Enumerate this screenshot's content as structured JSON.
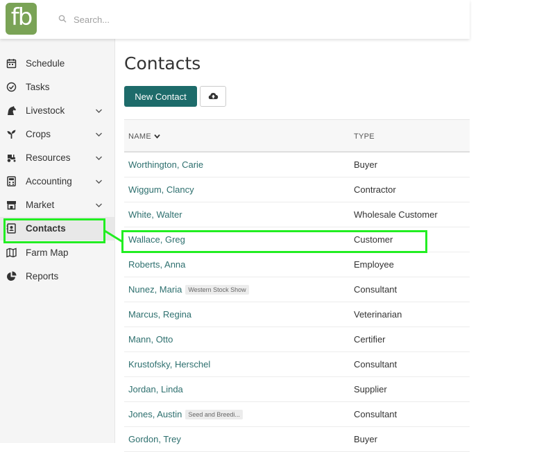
{
  "logo": {
    "text": "fb"
  },
  "search": {
    "placeholder": "Search..."
  },
  "sidebar": {
    "items": [
      {
        "label": "Schedule",
        "icon": "calendar-icon",
        "has_submenu": false
      },
      {
        "label": "Tasks",
        "icon": "check-circle-icon",
        "has_submenu": false
      },
      {
        "label": "Livestock",
        "icon": "horse-icon",
        "has_submenu": true
      },
      {
        "label": "Crops",
        "icon": "seedling-icon",
        "has_submenu": true
      },
      {
        "label": "Resources",
        "icon": "tractor-icon",
        "has_submenu": true
      },
      {
        "label": "Accounting",
        "icon": "calculator-icon",
        "has_submenu": true
      },
      {
        "label": "Market",
        "icon": "store-icon",
        "has_submenu": true
      },
      {
        "label": "Contacts",
        "icon": "address-book-icon",
        "has_submenu": false,
        "active": true
      },
      {
        "label": "Farm Map",
        "icon": "map-icon",
        "has_submenu": false
      },
      {
        "label": "Reports",
        "icon": "pie-chart-icon",
        "has_submenu": false
      }
    ]
  },
  "main": {
    "title": "Contacts",
    "new_button": "New Contact",
    "upload_icon": "cloud-upload-icon",
    "table": {
      "headers": {
        "name": "NAME",
        "type": "TYPE"
      },
      "rows": [
        {
          "name": "Worthington, Carie",
          "type": "Buyer",
          "tag": ""
        },
        {
          "name": "Wiggum, Clancy",
          "type": "Contractor",
          "tag": ""
        },
        {
          "name": "White, Walter",
          "type": "Wholesale Customer",
          "tag": ""
        },
        {
          "name": "Wallace, Greg",
          "type": "Customer",
          "tag": ""
        },
        {
          "name": "Roberts, Anna",
          "type": "Employee",
          "tag": ""
        },
        {
          "name": "Nunez, Maria",
          "type": "Consultant",
          "tag": "Western Stock Show"
        },
        {
          "name": "Marcus, Regina",
          "type": "Veterinarian",
          "tag": ""
        },
        {
          "name": "Mann, Otto",
          "type": "Certifier",
          "tag": ""
        },
        {
          "name": "Krustofsky, Herschel",
          "type": "Consultant",
          "tag": ""
        },
        {
          "name": "Jordan, Linda",
          "type": "Supplier",
          "tag": ""
        },
        {
          "name": "Jones, Austin",
          "type": "Consultant",
          "tag": "Seed and Breedi..."
        },
        {
          "name": "Gordon, Trey",
          "type": "Buyer",
          "tag": ""
        }
      ]
    }
  },
  "colors": {
    "brand": "#7aa356",
    "primary_button": "#1d6b6a",
    "link": "#2d6f6e",
    "highlight": "#22ee22"
  }
}
